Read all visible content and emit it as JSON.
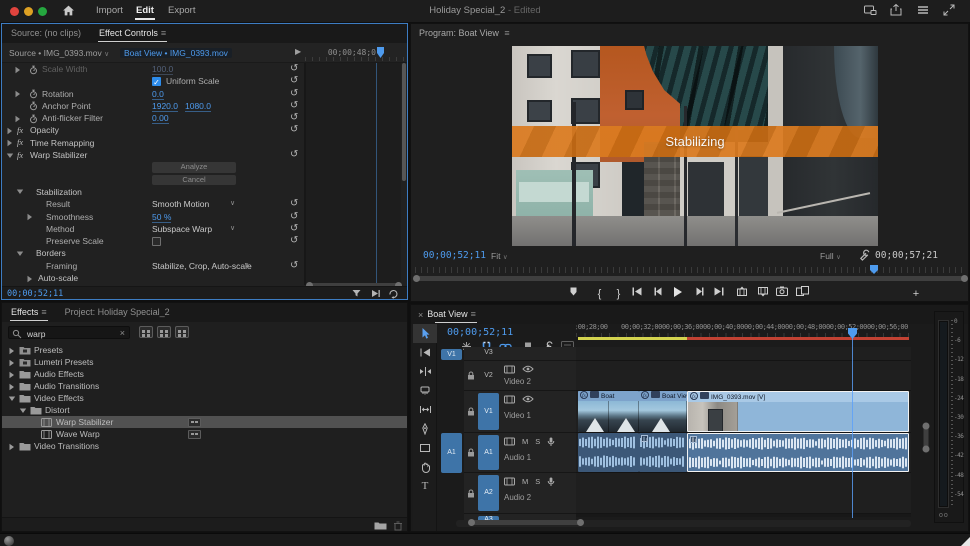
{
  "colors": {
    "accent_blue": "#4e9bee",
    "focus_border": "#3d7cc2",
    "track_badge_blue": "#3e74a8",
    "render_yellow": "#d3d34f",
    "render_red": "#c24233",
    "banner_orange": "#d97a1f",
    "selected_clip": "#8fb6d9"
  },
  "icons": {
    "panel_menu": "≡",
    "close": "×",
    "chevron_down": "∨",
    "chevron_right": "❯",
    "reset": "↺",
    "add": "+",
    "mark_in": "{",
    "mark_out": "}",
    "clear_search": "×"
  },
  "titlebar": {
    "menu": [
      {
        "label": "Import",
        "active": false
      },
      {
        "label": "Edit",
        "active": true
      },
      {
        "label": "Export",
        "active": false
      }
    ],
    "title": "Holiday Special_2",
    "title_suffix": "- Edited"
  },
  "effect_controls": {
    "tabs": [
      {
        "label": "Source: (no clips)",
        "active": false
      },
      {
        "label": "Effect Controls",
        "active": true
      }
    ],
    "source_label": "Source • IMG_0393.mov",
    "clip_label": "Boat View • IMG_0393.mov",
    "mini_ruler_timecode": "00;00;48;0",
    "rows": [
      {
        "type": "prop",
        "chev": "right",
        "stopwatch": true,
        "label": "Scale Width",
        "value": "100.0",
        "reset": true,
        "disabled": true,
        "indent": 1
      },
      {
        "type": "check",
        "label": "Uniform Scale",
        "checked": true,
        "reset": true,
        "indent": 1
      },
      {
        "type": "prop",
        "chev": "right",
        "stopwatch": true,
        "label": "Rotation",
        "value": "0.0",
        "reset": true,
        "indent": 1
      },
      {
        "type": "prop",
        "stopwatch": true,
        "label": "Anchor Point",
        "value": "1920.0",
        "value2": "1080.0",
        "reset": true,
        "indent": 1
      },
      {
        "type": "prop",
        "chev": "right",
        "stopwatch": true,
        "label": "Anti-flicker Filter",
        "value": "0.00",
        "reset": true,
        "indent": 1
      },
      {
        "type": "group",
        "chev": "right",
        "fx": true,
        "label": "Opacity",
        "reset": true
      },
      {
        "type": "group",
        "chev": "right",
        "fx": true,
        "label": "Time Remapping"
      },
      {
        "type": "group",
        "chev": "down",
        "fx": true,
        "label": "Warp Stabilizer",
        "reset": true
      },
      {
        "type": "button",
        "label": "Analyze"
      },
      {
        "type": "button",
        "label": "Cancel"
      },
      {
        "type": "section",
        "chev": "down",
        "label": "Stabilization",
        "indent": 1
      },
      {
        "type": "prop",
        "label": "Result",
        "dropdown": "Smooth Motion",
        "reset": true,
        "indent": 2
      },
      {
        "type": "prop",
        "chev": "right",
        "label": "Smoothness",
        "value": "50 %",
        "reset": true,
        "indent": 2
      },
      {
        "type": "prop",
        "label": "Method",
        "dropdown": "Subspace Warp",
        "reset": true,
        "indent": 2
      },
      {
        "type": "prop",
        "label": "Preserve Scale",
        "checkbox": "unchecked",
        "reset": true,
        "indent": 2
      },
      {
        "type": "section",
        "chev": "down",
        "label": "Borders",
        "indent": 1
      },
      {
        "type": "prop",
        "label": "Framing",
        "dropdown": "Stabilize, Crop, Auto-scale",
        "reset": true,
        "indent": 2
      },
      {
        "type": "section",
        "chev": "right",
        "label": "Auto-scale",
        "indent": 2
      }
    ],
    "timecode": "00;00;52;11"
  },
  "effects_panel": {
    "tabs": [
      {
        "label": "Effects",
        "active": true
      },
      {
        "label": "Project: Holiday Special_2",
        "active": false
      }
    ],
    "search_value": "warp",
    "tree": [
      {
        "depth": 0,
        "chev": "right",
        "icon": "preset-folder",
        "label": "Presets"
      },
      {
        "depth": 0,
        "chev": "right",
        "icon": "preset-folder",
        "label": "Lumetri Presets"
      },
      {
        "depth": 0,
        "chev": "right",
        "icon": "folder",
        "label": "Audio Effects"
      },
      {
        "depth": 0,
        "chev": "right",
        "icon": "folder",
        "label": "Audio Transitions"
      },
      {
        "depth": 0,
        "chev": "down",
        "icon": "folder",
        "label": "Video Effects"
      },
      {
        "depth": 1,
        "chev": "down",
        "icon": "folder",
        "label": "Distort"
      },
      {
        "depth": 2,
        "icon": "effect",
        "label": "Warp Stabilizer",
        "selected": true,
        "badge": true
      },
      {
        "depth": 2,
        "icon": "effect",
        "label": "Wave Warp",
        "badge": true
      },
      {
        "depth": 0,
        "chev": "right",
        "icon": "folder",
        "label": "Video Transitions"
      }
    ]
  },
  "program": {
    "header": "Program: Boat View",
    "banner_text": "Stabilizing",
    "timecode": "00;00;52;11",
    "zoom_level": "Fit",
    "playback_resolution": "Full",
    "duration": "00;00;57;21",
    "transport": [
      "add-marker",
      "mark-in",
      "mark-out",
      "go-to-in",
      "step-back",
      "play",
      "step-forward",
      "go-to-out",
      "lift",
      "extract",
      "export-frame",
      "comparison-view"
    ]
  },
  "timeline": {
    "tab": "Boat View",
    "timecode": "00;00;52;11",
    "ruler_labels": [
      ";00;28;00",
      "00;00;32;00",
      "00;00;36;00",
      "00;00;40;00",
      "00;00;44;00",
      "00;00;48;00",
      "00;00;52;00",
      "00;00;56;00"
    ],
    "source_patch": {
      "video": "V1",
      "audio": "A1"
    },
    "video_tracks": [
      {
        "badge": "V3",
        "thin": true
      },
      {
        "badge": "V2",
        "name": "Video 2",
        "targeted": false
      },
      {
        "badge": "V1",
        "name": "Video 1",
        "targeted": true
      }
    ],
    "audio_tracks": [
      {
        "badge": "A1",
        "name": "Audio 1",
        "targeted": true,
        "mute": "M",
        "solo": "S"
      },
      {
        "badge": "A2",
        "name": "Audio 2",
        "targeted": true,
        "mute": "M",
        "solo": "S"
      },
      {
        "badge": "A3",
        "partial": true
      }
    ],
    "video_clips": [
      {
        "name": "Boat",
        "selected": false
      },
      {
        "name": "Boat View.m",
        "selected": false
      },
      {
        "name": "IMG_0393.mov [V]",
        "selected": true
      }
    ],
    "audio_clips": [
      {
        "selected": false
      },
      {
        "selected": false
      },
      {
        "selected": true
      }
    ],
    "tools": [
      "selection",
      "track-select-forward",
      "ripple-edit",
      "razor",
      "slip",
      "pen",
      "rectangle",
      "hand",
      "type"
    ],
    "meter_labels": [
      "0",
      "-6",
      "-12",
      "-18",
      "-24",
      "-30",
      "-36",
      "-42",
      "-48",
      "-54"
    ]
  }
}
